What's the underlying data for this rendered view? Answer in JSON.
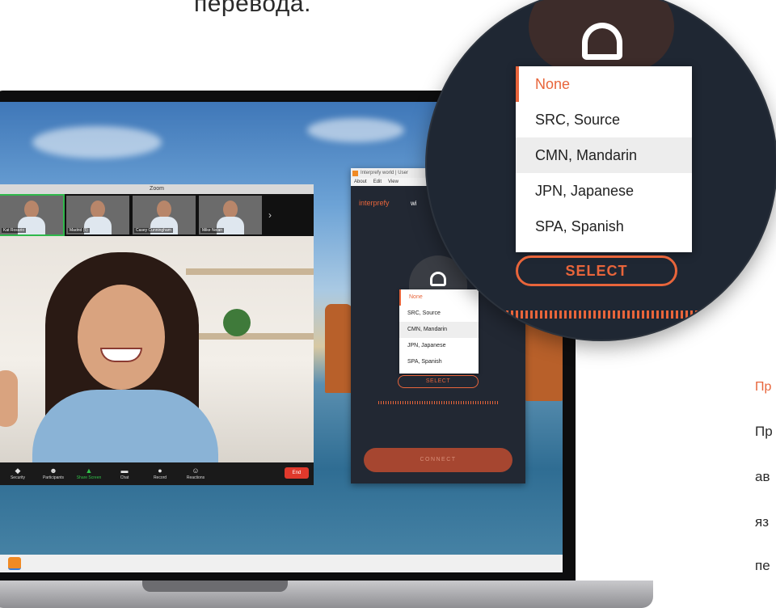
{
  "heading_fragment": "перевода.",
  "zoom": {
    "title": "Zoom",
    "thumbnails": [
      {
        "caption": "Kat Rosario",
        "active": true
      },
      {
        "caption": "Madrid (5)",
        "active": false
      },
      {
        "caption": "Casey Cunningham",
        "active": false
      },
      {
        "caption": "Mike Nolan",
        "active": false
      }
    ],
    "toolbar": [
      {
        "label": "Security",
        "icon": "◆"
      },
      {
        "label": "Participants",
        "icon": "☻"
      },
      {
        "label": "Share Screen",
        "icon": "▲"
      },
      {
        "label": "Chat",
        "icon": "▬"
      },
      {
        "label": "Record",
        "icon": "●"
      },
      {
        "label": "Reactions",
        "icon": "☺"
      }
    ],
    "end_label": "End"
  },
  "interprefy_window": {
    "title": "Interprefy world | User",
    "menu": [
      "About",
      "Edit",
      "View"
    ],
    "brand": "interprefy",
    "brand_suffix": "wi",
    "options": [
      "None",
      "SRC, Source",
      "CMN, Mandarin",
      "JPN, Japanese",
      "SPA, Spanish"
    ],
    "selected": "None",
    "highlighted": "CMN, Mandarin",
    "select_label": "SELECT",
    "connect_label": "CONNECT"
  },
  "magnifier": {
    "options": [
      "None",
      "SRC, Source",
      "CMN, Mandarin",
      "JPN, Japanese",
      "SPA, Spanish"
    ],
    "selected": "None",
    "highlighted": "CMN, Mandarin",
    "select_label": "SELECT"
  },
  "right_text": {
    "title_fragment": "Пр",
    "lines": [
      "Пр",
      "ав",
      "яз",
      "пе"
    ]
  },
  "colors": {
    "accent": "#e8653b",
    "panel": "#222833",
    "end": "#e0392c"
  }
}
